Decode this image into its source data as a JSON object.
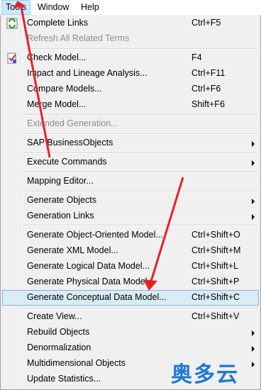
{
  "menubar": {
    "items": [
      {
        "label": "Tools",
        "active": true
      },
      {
        "label": "Window",
        "active": false
      },
      {
        "label": "Help",
        "active": false
      }
    ]
  },
  "menu": {
    "items": [
      {
        "label": "Complete Links",
        "shortcut": "Ctrl+F5",
        "icon": "refresh-links-icon"
      },
      {
        "label": "Refresh All Related Terms",
        "shortcut": "",
        "disabled": true
      },
      {
        "label": "Check Model...",
        "shortcut": "F4",
        "icon": "check-model-icon"
      },
      {
        "label": "Impact and Lineage Analysis...",
        "shortcut": "Ctrl+F11"
      },
      {
        "label": "Compare Models...",
        "shortcut": "Ctrl+F6"
      },
      {
        "label": "Merge Model...",
        "shortcut": "Shift+F6"
      },
      {
        "label": "Extended Generation...",
        "shortcut": "",
        "disabled": true
      },
      {
        "label": "SAP BusinessObjects",
        "submenu": true
      },
      {
        "label": "Execute Commands",
        "submenu": true
      },
      {
        "label": "Mapping Editor..."
      },
      {
        "label": "Generate Objects",
        "submenu": true
      },
      {
        "label": "Generation Links",
        "submenu": true
      },
      {
        "label": "Generate Object-Oriented Model...",
        "shortcut": "Ctrl+Shift+O"
      },
      {
        "label": "Generate XML Model...",
        "shortcut": "Ctrl+Shift+M"
      },
      {
        "label": "Generate Logical Data Model...",
        "shortcut": "Ctrl+Shift+L"
      },
      {
        "label": "Generate Physical Data Model...",
        "shortcut": "Ctrl+Shift+P"
      },
      {
        "label": "Generate Conceptual Data Model...",
        "shortcut": "Ctrl+Shift+C",
        "highlighted": true
      },
      {
        "label": "Create View...",
        "shortcut": "Ctrl+Shift+V"
      },
      {
        "label": "Rebuild Objects",
        "submenu": true
      },
      {
        "label": "Denormalization",
        "submenu": true
      },
      {
        "label": "Multidimensional Objects",
        "submenu": true
      },
      {
        "label": "Update Statistics..."
      }
    ]
  },
  "watermark": "奥多云",
  "colors": {
    "highlight": "#d9ebf7",
    "highlight_border": "#7fb5d9",
    "annotation_arrow": "#e8202a",
    "watermark": "#1e78d2"
  }
}
